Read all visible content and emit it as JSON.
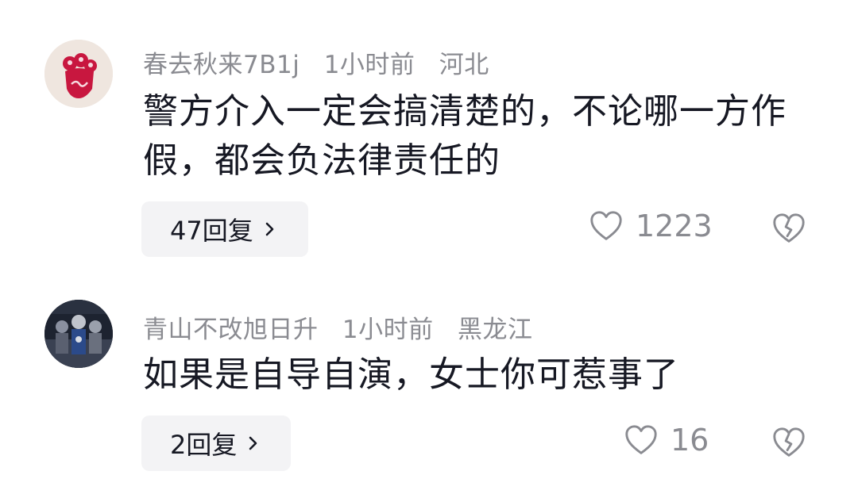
{
  "comments": [
    {
      "username": "春去秋来7B1j",
      "time": "1小时前",
      "location": "河北",
      "text": "警方介入一定会搞清楚的，不论哪一方作假，都会负法律责任的",
      "replies_label": "47回复",
      "likes": "1223",
      "avatar_icon": "red-flower-avatar-icon"
    },
    {
      "username": "青山不改旭日升",
      "time": "1小时前",
      "location": "黑龙江",
      "text": "如果是自导自演，女士你可惹事了",
      "replies_label": "2回复",
      "likes": "16",
      "avatar_icon": "superhero-group-avatar-icon"
    }
  ],
  "colors": {
    "meta_text": "#8a8b91",
    "body_text": "#161823",
    "reply_bg": "#f3f3f5"
  }
}
